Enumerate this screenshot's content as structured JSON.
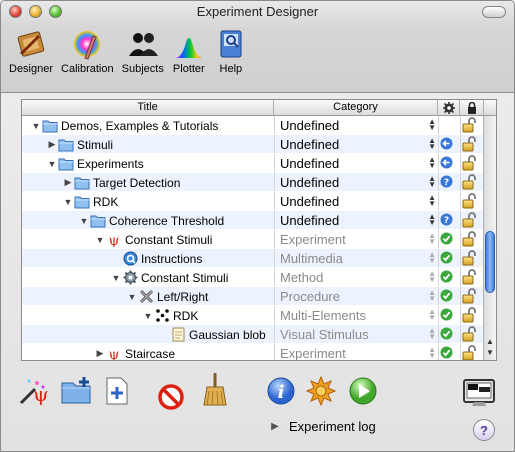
{
  "window": {
    "title": "Experiment Designer"
  },
  "toolbar": {
    "items": [
      {
        "label": "Designer",
        "icon": "designer-icon"
      },
      {
        "label": "Calibration",
        "icon": "calibration-icon"
      },
      {
        "label": "Subjects",
        "icon": "subjects-icon"
      },
      {
        "label": "Plotter",
        "icon": "plotter-icon"
      },
      {
        "label": "Help",
        "icon": "help-book-icon"
      }
    ]
  },
  "table": {
    "columns": {
      "title": "Title",
      "category": "Category",
      "status": "status-gear-icon",
      "lock": "lock-icon"
    },
    "rows": [
      {
        "title": "Demos, Examples & Tutorials",
        "category": "Undefined",
        "indent": 0,
        "tri": "open",
        "icon": "folder",
        "status": "",
        "lock": "open"
      },
      {
        "title": "Stimuli",
        "category": "Undefined",
        "indent": 1,
        "tri": "closed",
        "icon": "folder",
        "status": "back",
        "lock": "open"
      },
      {
        "title": "Experiments",
        "category": "Undefined",
        "indent": 1,
        "tri": "open",
        "icon": "folder",
        "status": "back",
        "lock": "open"
      },
      {
        "title": "Target Detection",
        "category": "Undefined",
        "indent": 2,
        "tri": "closed",
        "icon": "folder",
        "status": "help",
        "lock": "open"
      },
      {
        "title": "RDK",
        "category": "Undefined",
        "indent": 2,
        "tri": "open",
        "icon": "folder",
        "status": "",
        "lock": "open"
      },
      {
        "title": "Coherence Threshold",
        "category": "Undefined",
        "indent": 3,
        "tri": "open",
        "icon": "folder",
        "status": "help",
        "lock": "open"
      },
      {
        "title": "Constant Stimuli",
        "category": "Experiment",
        "indent": 4,
        "tri": "open",
        "icon": "psi",
        "status": "check",
        "lock": "open",
        "gray": true
      },
      {
        "title": "Instructions",
        "category": "Multimedia",
        "indent": 5,
        "tri": "",
        "icon": "quicktime",
        "status": "check",
        "lock": "open",
        "gray": true
      },
      {
        "title": "Constant Stimuli",
        "category": "Method",
        "indent": 5,
        "tri": "open",
        "icon": "gear",
        "status": "check",
        "lock": "open",
        "gray": true
      },
      {
        "title": "Left/Right",
        "category": "Procedure",
        "indent": 6,
        "tri": "open",
        "icon": "cross",
        "status": "check",
        "lock": "open",
        "gray": true
      },
      {
        "title": "RDK",
        "category": "Multi-Elements",
        "indent": 7,
        "tri": "open",
        "icon": "dots",
        "status": "check",
        "lock": "open",
        "gray": true
      },
      {
        "title": "Gaussian blob",
        "category": "Visual Stimulus",
        "indent": 8,
        "tri": "",
        "icon": "note",
        "status": "check",
        "lock": "open",
        "gray": true
      },
      {
        "title": "Staircase",
        "category": "Experiment",
        "indent": 4,
        "tri": "closed",
        "icon": "psi",
        "status": "check",
        "lock": "open",
        "gray": true
      }
    ]
  },
  "bottom": {
    "experiment_log": "Experiment log",
    "help": "?"
  }
}
